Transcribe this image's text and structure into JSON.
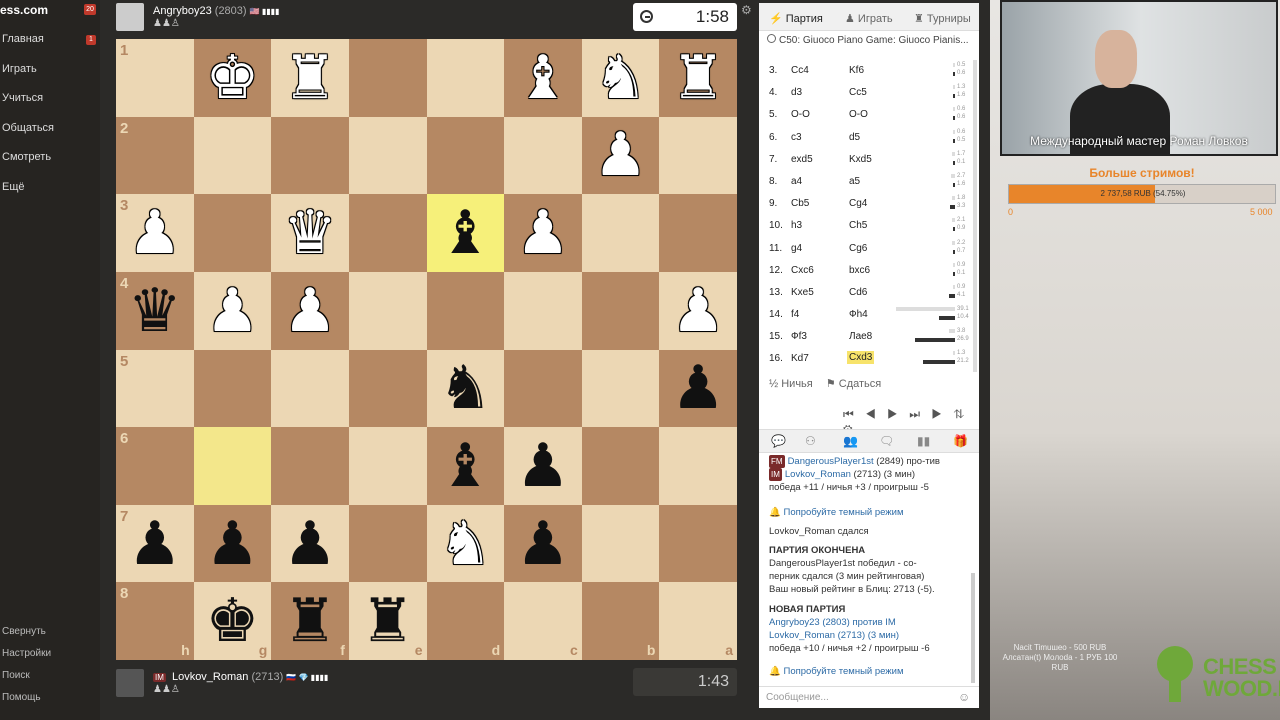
{
  "sidebar": {
    "brand": "ess.com",
    "brand_badge": "20",
    "items": [
      {
        "label": "Главная",
        "badge": "1"
      },
      {
        "label": "Играть"
      },
      {
        "label": "Учиться"
      },
      {
        "label": "Общаться"
      },
      {
        "label": "Смотреть"
      },
      {
        "label": "Ещё"
      }
    ],
    "bottom_items": [
      "Свернуть",
      "Настройки",
      "Поиск",
      "Помощь"
    ]
  },
  "top_player": {
    "name": "Angryboy23",
    "rating": "(2803)",
    "flag": "🇺🇸 ▮▮▮▮",
    "status": "♟♟♙"
  },
  "bottom_player": {
    "title": "IM",
    "name": "Lovkov_Roman",
    "rating": "(2713)",
    "flag": "🇷🇺 💎 ▮▮▮▮",
    "status": "♟♟♙"
  },
  "clocks": {
    "top": "1:58",
    "bottom": "1:43"
  },
  "board": {
    "ranks": [
      "1",
      "2",
      "3",
      "4",
      "5",
      "6",
      "7",
      "8"
    ],
    "files": [
      "h",
      "g",
      "f",
      "e",
      "d",
      "c",
      "b",
      "a"
    ],
    "rows": [
      [
        "",
        "wK",
        "wR",
        "",
        "",
        "wB",
        "wN",
        "wR"
      ],
      [
        "",
        "",
        "",
        "",
        "",
        "",
        "wP",
        ""
      ],
      [
        "wP",
        "",
        "wQ",
        "",
        "bB",
        "wP",
        "",
        ""
      ],
      [
        "bQ",
        "wP",
        "wP",
        "",
        "",
        "",
        "",
        "wP"
      ],
      [
        "",
        "",
        "",
        "",
        "bN",
        "",
        "",
        "bP"
      ],
      [
        "",
        "",
        "",
        "",
        "bB",
        "bP",
        "",
        ""
      ],
      [
        "bP",
        "bP",
        "bP",
        "",
        "wN",
        "bP",
        "",
        ""
      ],
      [
        "",
        "bK",
        "bR",
        "bR",
        "",
        "",
        "",
        ""
      ]
    ],
    "highlights": [
      {
        "row": 2,
        "col": 4
      },
      {
        "row": 5,
        "col": 1
      }
    ]
  },
  "panel": {
    "tabs": [
      "Партия",
      "Играть",
      "Турниры"
    ],
    "opening": "C50: Giuoco Piano Game: Giuoco Pianis...",
    "moves": [
      {
        "num": "3.",
        "white": "Cc4",
        "black": "Kf6",
        "t1": "0.5",
        "t2": "0.6"
      },
      {
        "num": "4.",
        "white": "d3",
        "black": "Cc5",
        "t1": "1.3",
        "t2": "1.6"
      },
      {
        "num": "5.",
        "white": "O-O",
        "black": "O-O",
        "t1": "0.6",
        "t2": "0.6"
      },
      {
        "num": "6.",
        "white": "c3",
        "black": "d5",
        "t1": "0.6",
        "t2": "0.5"
      },
      {
        "num": "7.",
        "white": "exd5",
        "black": "Kxd5",
        "t1": "1.7",
        "t2": "0.1"
      },
      {
        "num": "8.",
        "white": "a4",
        "black": "a5",
        "t1": "2.7",
        "t2": "1.6"
      },
      {
        "num": "9.",
        "white": "Cb5",
        "black": "Cg4",
        "t1": "1.8",
        "t2": "3.3"
      },
      {
        "num": "10.",
        "white": "h3",
        "black": "Ch5",
        "t1": "2.1",
        "t2": "0.9"
      },
      {
        "num": "11.",
        "white": "g4",
        "black": "Cg6",
        "t1": "2.2",
        "t2": "0.7"
      },
      {
        "num": "12.",
        "white": "Cxc6",
        "black": "bxc6",
        "t1": "0.9",
        "t2": "0.1"
      },
      {
        "num": "13.",
        "white": "Kxe5",
        "black": "Cd6",
        "t1": "0.9",
        "t2": "4.1"
      },
      {
        "num": "14.",
        "white": "f4",
        "black": "Фh4",
        "t1": "39.1",
        "t2": "10.4"
      },
      {
        "num": "15.",
        "white": "Фf3",
        "black": "Лае8",
        "t1": "3.8",
        "t2": "26.9"
      },
      {
        "num": "16.",
        "white": "Kd7",
        "black": "Cxd3",
        "t1": "1.3",
        "t2": "21.2"
      }
    ],
    "draw_label": "½ Ничья",
    "resign_label": "Сдаться",
    "controls": "⏮ ◀ ▶ ⏭ ▶ ⇅ ⚙"
  },
  "chat": {
    "lines": [
      {
        "badge": "FM",
        "user": "DangerousPlayer1st",
        "text1": "(2849) про-"
      },
      {
        "text": "тив"
      },
      {
        "text": "победа +11 / ничья +3 / проигрыш -5"
      },
      {
        "text": "Попробуйте темный режим"
      },
      {
        "text": "Lovkov_Roman сдался"
      },
      {
        "text": "ПАРТИЯ ОКОНЧЕНА"
      },
      {
        "text": "DangerousPlayer1st победил - со-"
      },
      {
        "text": "перник сдался (3 мин рейтинговая)"
      },
      {
        "text": "Ваш новый рейтинг в Блиц: 2713 (-5)."
      },
      {
        "text": "НОВАЯ ПАРТИЯ"
      },
      {
        "text": "Angryboy23 (2803) против IM"
      },
      {
        "text": "Lovkov_Roman (2713) (3 мин)"
      },
      {
        "text": "победа +10 / ничья +2 / проигрыш -6"
      },
      {
        "text": "Попробуйте темный режим"
      }
    ],
    "user_lovkov": "Lovkov_Roman",
    "rating_lovkov": "(2713) (3 мин)",
    "placeholder": "Сообщение..."
  },
  "stream": {
    "caption": "Международный мастер Роман Ловков",
    "donation_title": "Больше стримов!",
    "donation_amount": "2 737,58 RUB (54.75%)",
    "donation_progress": 0.5475,
    "donation_min": "0",
    "donation_max": "5 000",
    "overlay": "Nacit Timuшeo - 500 RUB Алсaтaн(t) Moлoda - 1 РУБ 100 RUB",
    "logo_line1": "CHESS",
    "logo_line2": "WOOD.RU",
    "accent": "#e8852a",
    "logo_color": "#6fa83a"
  }
}
